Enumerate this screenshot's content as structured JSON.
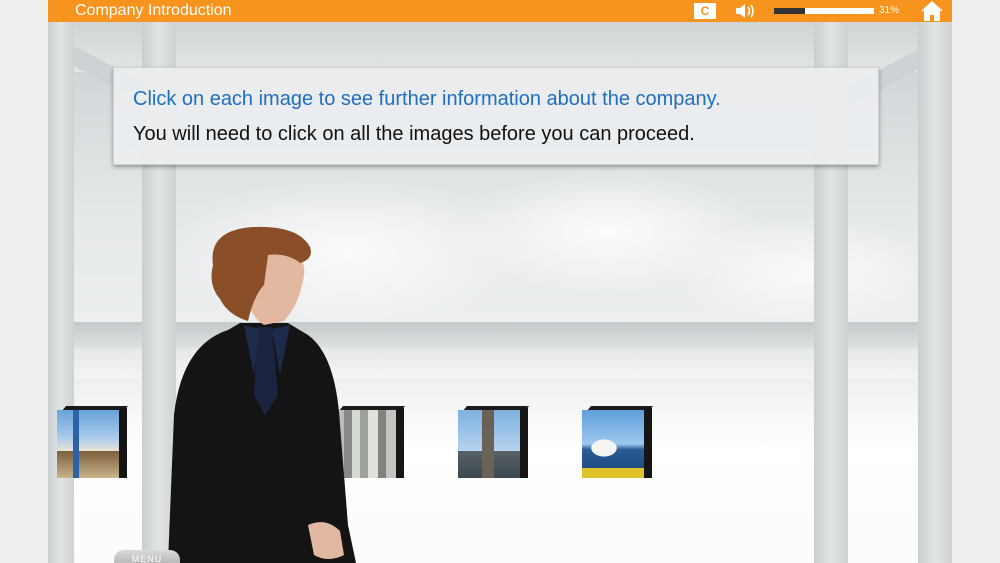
{
  "header": {
    "title": "Company Introduction",
    "cc_label": "C",
    "progress_percent": 31,
    "progress_label": "31%"
  },
  "instructions": {
    "line1": "Click on each image to see further information about the company.",
    "line2": "You will need to click on all the images before you can proceed."
  },
  "images": [
    {
      "name": "city-street",
      "icon": "photo-times-square"
    },
    {
      "name": "skyscrapers",
      "icon": "photo-skyscrapers"
    },
    {
      "name": "bridge",
      "icon": "photo-bridge"
    },
    {
      "name": "harbour",
      "icon": "photo-sydney-opera-house"
    }
  ],
  "menu": {
    "label": "MENU"
  },
  "colors": {
    "accent": "#f7941d",
    "instruction_blue": "#1f6fbf",
    "text": "#111111"
  }
}
